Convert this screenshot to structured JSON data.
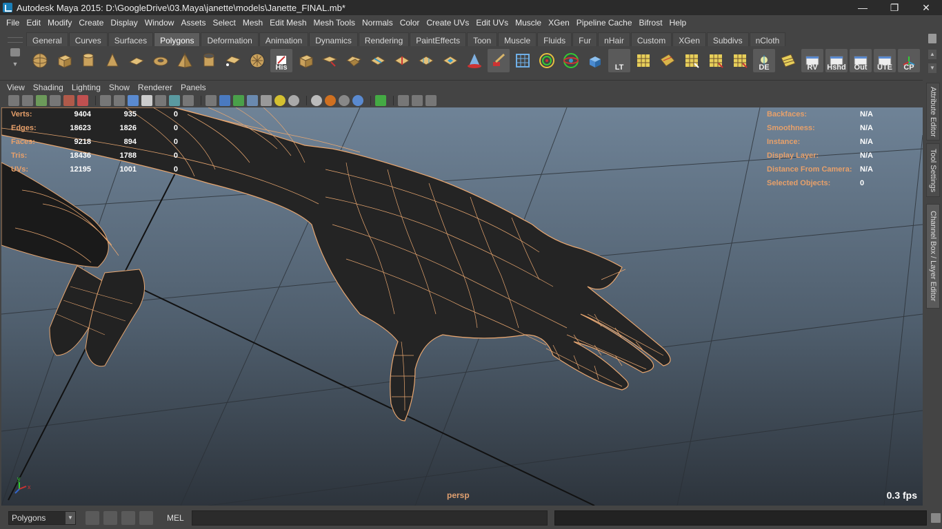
{
  "window": {
    "title": "Autodesk Maya 2015: D:\\GoogleDrive\\03.Maya\\janette\\models\\Janette_FINAL.mb*",
    "minimize": "—",
    "maximize": "❐",
    "close": "✕"
  },
  "menubar": [
    "File",
    "Edit",
    "Modify",
    "Create",
    "Display",
    "Window",
    "Assets",
    "Select",
    "Mesh",
    "Edit Mesh",
    "Mesh Tools",
    "Normals",
    "Color",
    "Create UVs",
    "Edit UVs",
    "Muscle",
    "XGen",
    "Pipeline Cache",
    "Bifrost",
    "Help"
  ],
  "shelf": {
    "tabs": [
      "General",
      "Curves",
      "Surfaces",
      "Polygons",
      "Deformation",
      "Animation",
      "Dynamics",
      "Rendering",
      "PaintEffects",
      "Toon",
      "Muscle",
      "Fluids",
      "Fur",
      "nHair",
      "Custom",
      "XGen",
      "Subdivs",
      "nCloth"
    ],
    "active_tab": "Polygons",
    "icon_labels": {
      "history": "His",
      "lt": "LT",
      "de": "DE",
      "rv": "RV",
      "hshd": "Hshd",
      "out": "Out",
      "ute": "UTE",
      "cp": "CP"
    }
  },
  "panel_menu": [
    "View",
    "Shading",
    "Lighting",
    "Show",
    "Renderer",
    "Panels"
  ],
  "hud_left": [
    {
      "key": "Verts:",
      "a": "9404",
      "b": "935",
      "c": "0"
    },
    {
      "key": "Edges:",
      "a": "18623",
      "b": "1826",
      "c": "0"
    },
    {
      "key": "Faces:",
      "a": "9218",
      "b": "894",
      "c": "0"
    },
    {
      "key": "Tris:",
      "a": "18436",
      "b": "1788",
      "c": "0"
    },
    {
      "key": "UVs:",
      "a": "12195",
      "b": "1001",
      "c": "0"
    }
  ],
  "hud_right": [
    {
      "key": "Backfaces:",
      "value": "N/A"
    },
    {
      "key": "Smoothness:",
      "value": "N/A"
    },
    {
      "key": "Instance:",
      "value": "N/A"
    },
    {
      "key": "Display Layer:",
      "value": "N/A"
    },
    {
      "key": "Distance From Camera:",
      "value": "N/A"
    },
    {
      "key": "Selected Objects:",
      "value": "0"
    }
  ],
  "viewport": {
    "camera": "persp",
    "fps": "0.3 fps",
    "axis_y": "y",
    "axis_x": "x"
  },
  "side_tabs": [
    "Attribute Editor",
    "Tool Settings",
    "Channel Box / Layer Editor"
  ],
  "command_line": {
    "mode": "Polygons",
    "language": "MEL"
  },
  "colors": {
    "wireframe": "#e9a770",
    "hud_label": "#e7a06a",
    "ui_bg": "#444444"
  }
}
